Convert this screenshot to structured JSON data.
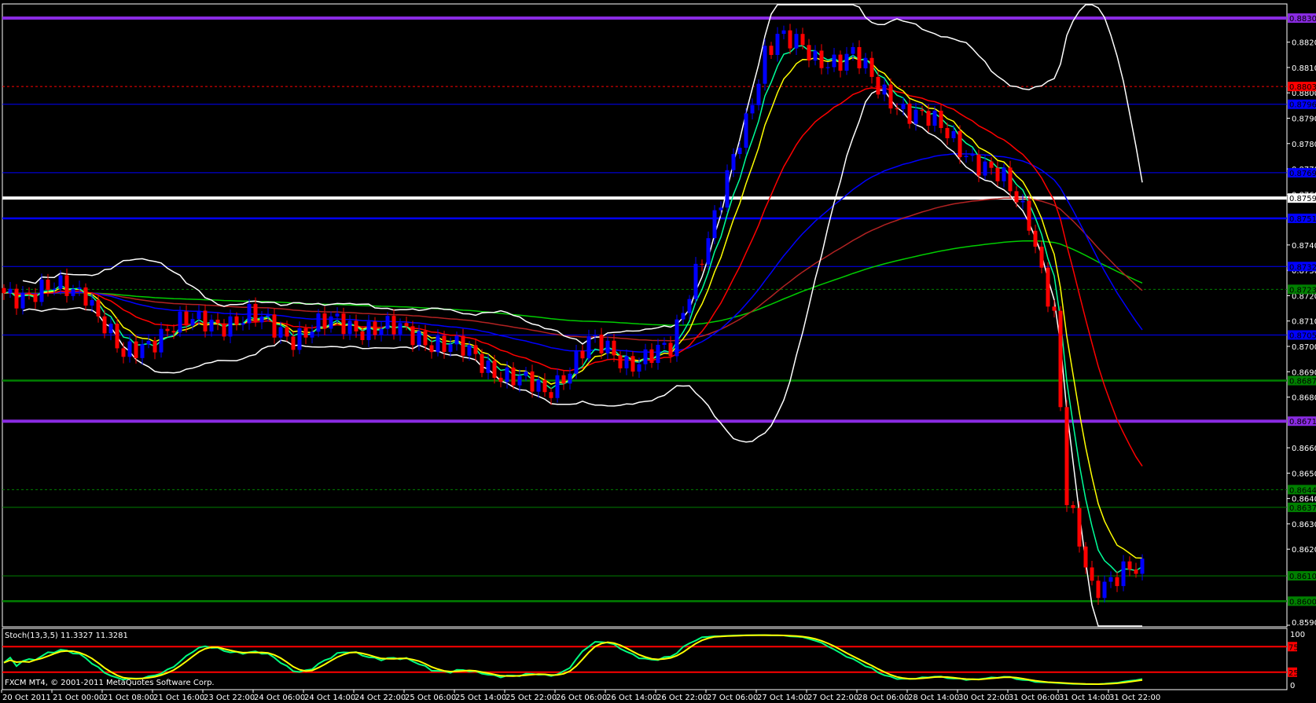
{
  "chart_data": {
    "type": "candlestick",
    "symbol_timeframe": "H1",
    "price_range": [
      0.85905,
      0.883
    ],
    "bar_count": 182,
    "price_path": [
      [
        0,
        0.87215
      ],
      [
        13,
        0.8723
      ],
      [
        19,
        0.8695
      ],
      [
        26,
        0.87083
      ],
      [
        39,
        0.87116
      ],
      [
        46,
        0.8705
      ],
      [
        53,
        0.87099
      ],
      [
        66,
        0.8705
      ],
      [
        73,
        0.86983
      ],
      [
        86,
        0.86817
      ],
      [
        93,
        0.87016
      ],
      [
        99,
        0.8695
      ],
      [
        106,
        0.86983
      ],
      [
        110,
        0.87315
      ],
      [
        114,
        0.8758
      ],
      [
        118,
        0.87879
      ],
      [
        121,
        0.88177
      ],
      [
        123,
        0.88244
      ],
      [
        129,
        0.88128
      ],
      [
        135,
        0.88161
      ],
      [
        139,
        0.88011
      ],
      [
        146,
        0.87912
      ],
      [
        153,
        0.87779
      ],
      [
        159,
        0.87647
      ],
      [
        163,
        0.87514
      ],
      [
        167,
        0.87116
      ],
      [
        169,
        0.86386
      ],
      [
        171,
        0.8622
      ],
      [
        173,
        0.86054
      ],
      [
        175,
        0.86087
      ],
      [
        178,
        0.8612
      ],
      [
        181,
        0.86104
      ]
    ],
    "price_ticks": [
      "0.88205",
      "0.88105",
      "0.88005",
      "0.87905",
      "0.87805",
      "0.87705",
      "0.87605",
      "0.87405",
      "0.87305",
      "0.87205",
      "0.87105",
      "0.87005",
      "0.86905",
      "0.86805",
      "0.86605",
      "0.86505",
      "0.86405",
      "0.86305",
      "0.86205",
      "0.85905"
    ],
    "levels": [
      {
        "price": "0.88300",
        "color": "#8a2be2",
        "style": "thick"
      },
      {
        "price": "0.88030",
        "color": "#ff0000",
        "style": "dashed"
      },
      {
        "price": "0.87960",
        "color": "#0000ff",
        "style": "thin"
      },
      {
        "price": "0.87690",
        "color": "#0000ff",
        "style": "thin"
      },
      {
        "price": "0.87590",
        "color": "#ffffff",
        "style": "thick"
      },
      {
        "price": "0.87510",
        "color": "#0000ff",
        "style": "medium"
      },
      {
        "price": "0.87320",
        "color": "#0000ff",
        "style": "thin"
      },
      {
        "price": "0.87230",
        "color": "#008000",
        "style": "dashed"
      },
      {
        "price": "0.87050",
        "color": "#0000ff",
        "style": "thin"
      },
      {
        "price": "0.86870",
        "color": "#008000",
        "style": "medium"
      },
      {
        "price": "0.86710",
        "color": "#8a2be2",
        "style": "thick"
      },
      {
        "price": "0.86440",
        "color": "#008000",
        "style": "dashed"
      },
      {
        "price": "0.86370",
        "color": "#008000",
        "style": "thin"
      },
      {
        "price": "0.86100",
        "color": "#008000",
        "style": "thin"
      },
      {
        "price": "0.86000",
        "color": "#008000",
        "style": "medium"
      }
    ],
    "moving_averages": [
      {
        "period": 5,
        "color": "#00ff99"
      },
      {
        "period": 8,
        "color": "#ffff00"
      },
      {
        "period": 21,
        "color": "#ff0000"
      },
      {
        "period": 55,
        "color": "#0000ff"
      },
      {
        "period": 100,
        "color": "#b22222"
      },
      {
        "period": 200,
        "color": "#00cc00"
      }
    ],
    "bollinger": {
      "period": 20,
      "deviation": 2,
      "color": "#ffffff"
    },
    "stochastic": {
      "k": 13,
      "d": 3,
      "slowing": 5,
      "levels": [
        "75",
        "25"
      ],
      "scale_labels": [
        "100",
        "0"
      ],
      "main_color": "#00ff80",
      "signal_color": "#ffff00"
    },
    "time_labels": [
      "20 Oct 2011",
      "21 Oct 00:00",
      "21 Oct 08:00",
      "21 Oct 16:00",
      "23 Oct 22:00",
      "24 Oct 06:00",
      "24 Oct 14:00",
      "24 Oct 22:00",
      "25 Oct 06:00",
      "25 Oct 14:00",
      "25 Oct 22:00",
      "26 Oct 06:00",
      "26 Oct 14:00",
      "26 Oct 22:00",
      "27 Oct 06:00",
      "27 Oct 14:00",
      "27 Oct 22:00",
      "28 Oct 06:00",
      "28 Oct 14:00",
      "30 Oct 22:00",
      "31 Oct 06:00",
      "31 Oct 14:00",
      "31 Oct 22:00"
    ],
    "colors": {
      "bull": "#0000ff",
      "bear": "#ff0000",
      "axis": "#ffffff"
    }
  },
  "indicator_label": "Stoch(13,3,5) 11.3327 11.3281",
  "copyright": "FXCM MT4, © 2001-2011 MetaQuotes Software Corp."
}
